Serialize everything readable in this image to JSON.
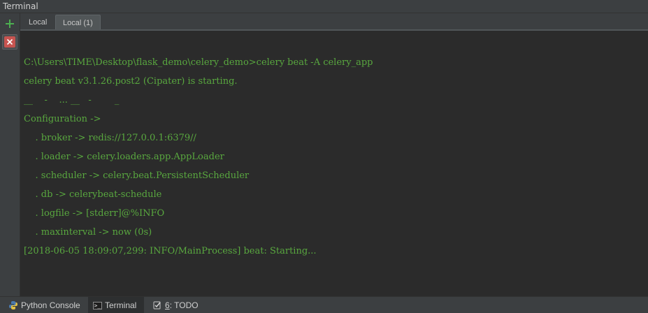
{
  "window": {
    "title": "Terminal"
  },
  "toolbar": {
    "add_icon": "plus-icon",
    "close_icon": "close-session-icon",
    "accent_add": "#4caf50",
    "accent_close": "#c75450"
  },
  "tabs": [
    {
      "label": "Local"
    },
    {
      "label": "Local (1)",
      "active": true
    }
  ],
  "terminal": {
    "text_color": "#59a83f",
    "lines": [
      "C:\\Users\\TIME\\Desktop\\flask_demo\\celery_demo>celery beat -A celery_app",
      "celery beat v3.1.26.post2 (Cipater) is starting.",
      "__    -    ... __   -        _",
      "Configuration ->",
      "    . broker -> redis://127.0.0.1:6379//",
      "    . loader -> celery.loaders.app.AppLoader",
      "    . scheduler -> celery.beat.PersistentScheduler",
      "    . db -> celerybeat-schedule",
      "    . logfile -> [stderr]@%INFO",
      "    . maxinterval -> now (0s)",
      "[2018-06-05 18:09:07,299: INFO/MainProcess] beat: Starting..."
    ]
  },
  "bottom_tabs": {
    "python_console": {
      "label": "Python Console",
      "icon": "python-icon"
    },
    "terminal": {
      "label": "Terminal",
      "icon": "terminal-icon",
      "active": true
    },
    "todo": {
      "key": "6",
      "label": ": TODO",
      "icon": "todo-icon"
    }
  }
}
